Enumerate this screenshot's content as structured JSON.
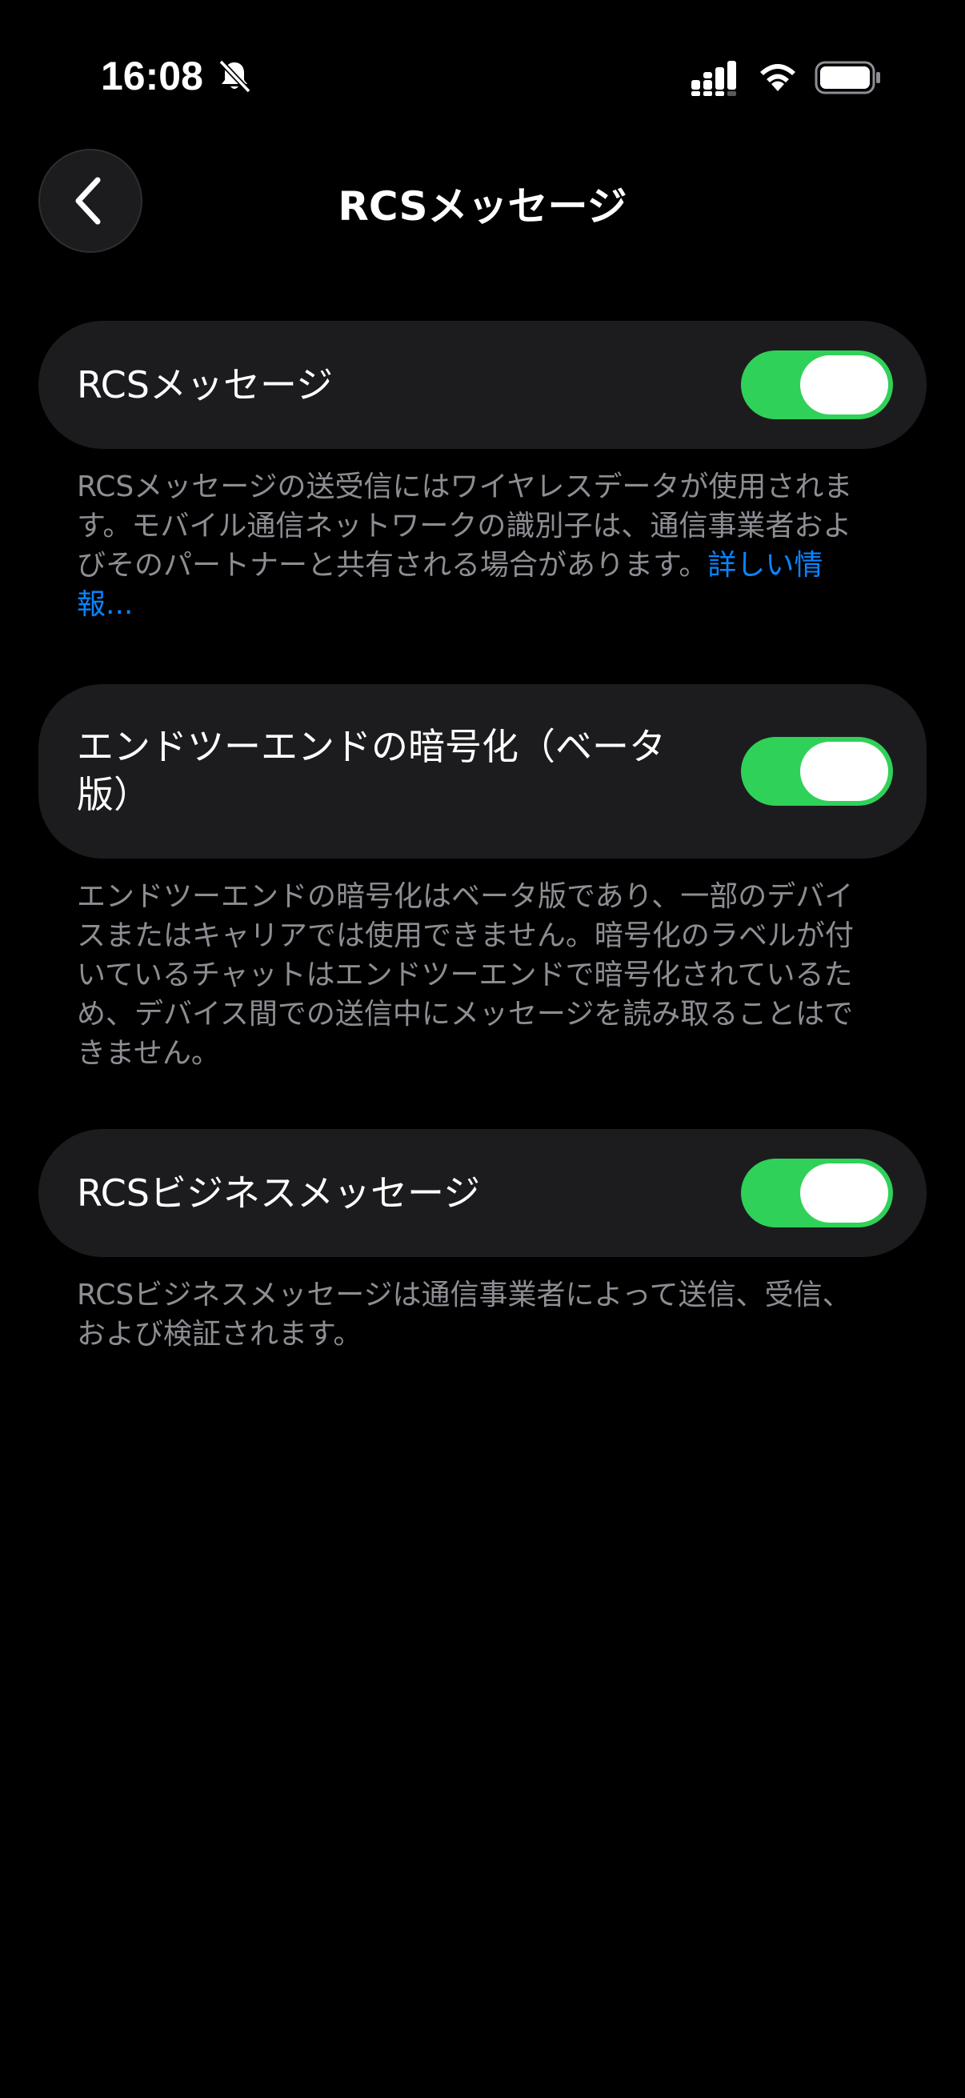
{
  "status_bar": {
    "time": "16:08",
    "icons": [
      "bell-slash-icon",
      "cellular-signal-icon",
      "wifi-icon",
      "battery-icon"
    ]
  },
  "nav": {
    "back_icon": "chevron-left-icon",
    "title": "RCSメッセージ"
  },
  "settings": {
    "rcs": {
      "label": "RCSメッセージ",
      "enabled": true,
      "footnote": "RCSメッセージの送受信にはワイヤレスデータが使用されます。モバイル通信ネットワークの識別子は、通信事業者およびそのパートナーと共有される場合があります。",
      "link": "詳しい情報..."
    },
    "e2ee": {
      "label": "エンドツーエンドの暗号化（ベータ版）",
      "enabled": true,
      "footnote": "エンドツーエンドの暗号化はベータ版であり、一部のデバイスまたはキャリアでは使用できません。暗号化のラベルが付いているチャットはエンドツーエンドで暗号化されているため、デバイス間での送信中にメッセージを読み取ることはできません。"
    },
    "business": {
      "label": "RCSビジネスメッセージ",
      "enabled": true,
      "footnote": "RCSビジネスメッセージは通信事業者によって送信、受信、および検証されます。"
    }
  },
  "colors": {
    "background": "#000000",
    "card": "#1c1c1e",
    "toggle_on": "#30d158",
    "footnote": "#8d8d93",
    "link": "#0a84ff"
  }
}
